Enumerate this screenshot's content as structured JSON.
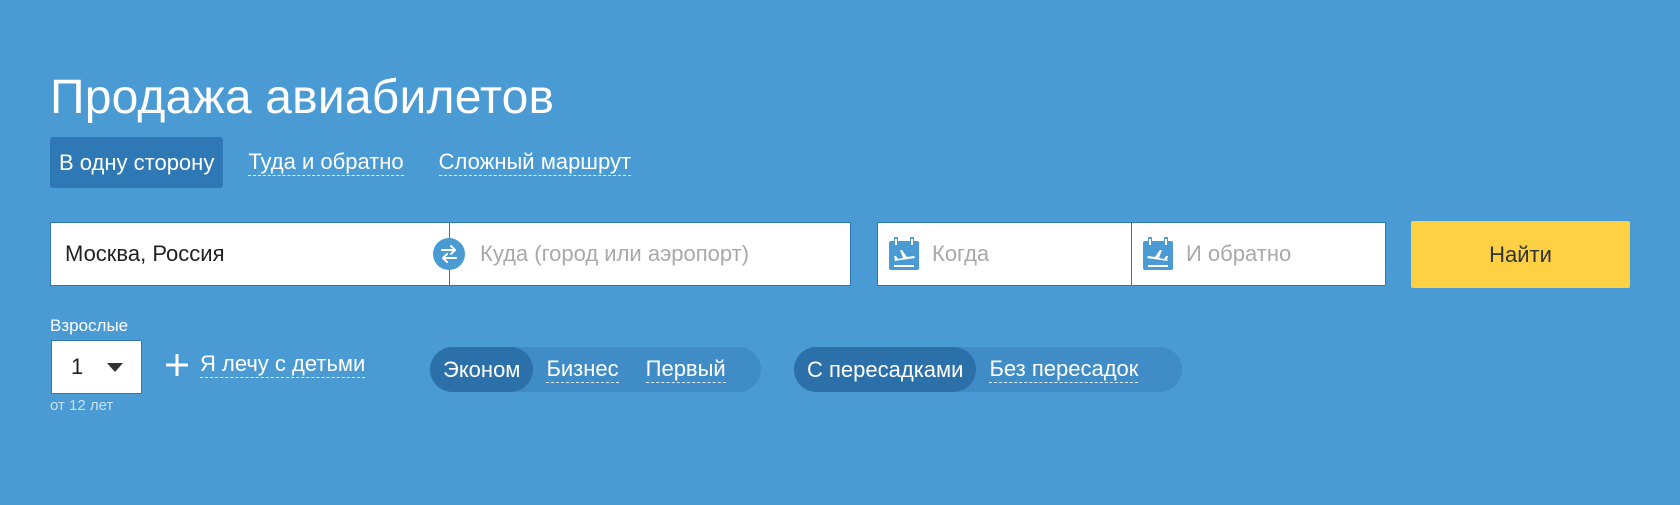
{
  "page": {
    "title": "Продажа авиабилетов"
  },
  "trip_type": {
    "tabs": [
      {
        "label": "В одну сторону",
        "active": true
      },
      {
        "label": "Туда и обратно",
        "active": false
      },
      {
        "label": "Сложный маршрут",
        "active": false
      }
    ]
  },
  "search": {
    "origin_value": "Москва, Россия",
    "destination_placeholder": "Куда (город или аэропорт)",
    "depart_placeholder": "Когда",
    "return_placeholder": "И обратно",
    "submit_label": "Найти",
    "swap_icon": "swap-arrows-icon",
    "calendar_icon": "calendar-plane-icon"
  },
  "passengers": {
    "adults_label": "Взрослые",
    "adults_value": "1",
    "adults_hint": "от 12 лет",
    "kids_link": "Я лечу с детьми"
  },
  "cabin_class": {
    "options": [
      {
        "label": "Эконом",
        "selected": true
      },
      {
        "label": "Бизнес",
        "selected": false
      },
      {
        "label": "Первый",
        "selected": false
      }
    ]
  },
  "stops": {
    "options": [
      {
        "label": "С пересадками",
        "selected": true
      },
      {
        "label": "Без пересадок",
        "selected": false
      }
    ]
  },
  "colors": {
    "background": "#4a9bd4",
    "active_tab": "#2f78b6",
    "search_button": "#fdd143",
    "segment_track": "#3f8cc6",
    "segment_active": "#2c70aa"
  }
}
